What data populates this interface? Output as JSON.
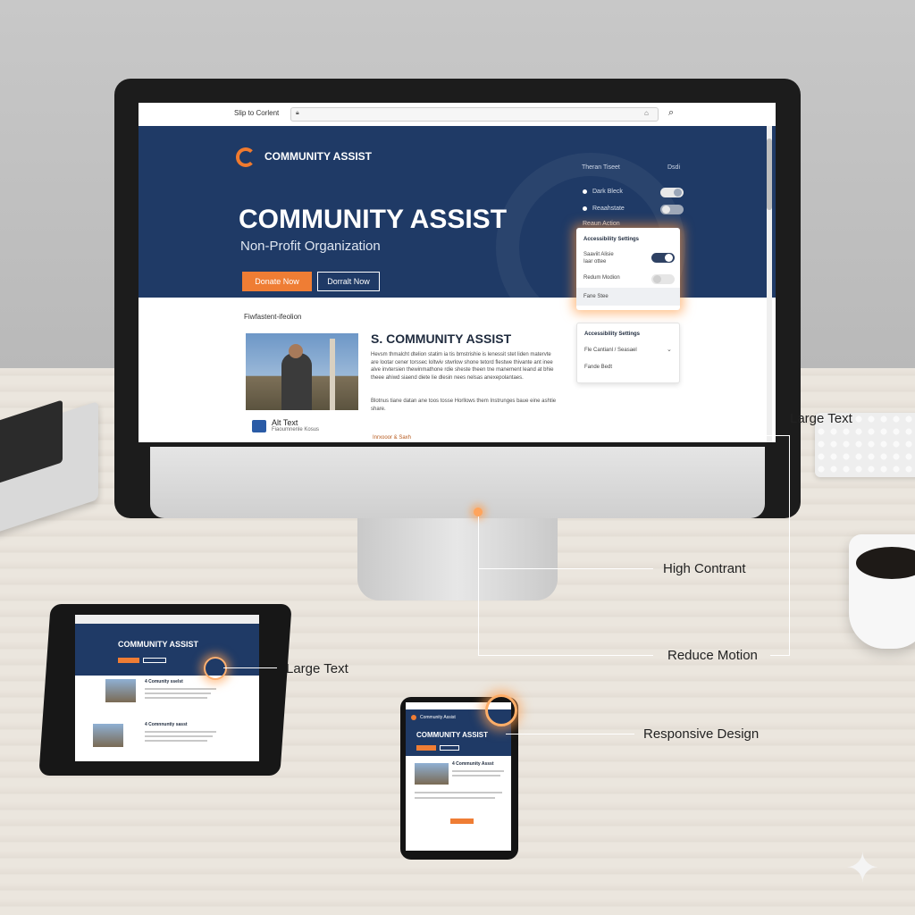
{
  "desktop": {
    "address_bar": {
      "skip_link": "Slip to Corlent"
    },
    "brand": {
      "logo_text": "COMMUNITY ASSIST"
    },
    "hero": {
      "title": "COMMUNITY ASSIST",
      "subtitle": "Non-Profit Organization",
      "primary_button": "Donate Now",
      "secondary_button": "Dorralt Now"
    },
    "settings_bar": {
      "heading": "Theran Tiseet",
      "edit": "Dsdi",
      "options": [
        {
          "label": "Dark Bleck",
          "toggle_on": true
        },
        {
          "label": "Reaahstate",
          "toggle_on": false
        },
        {
          "label": "Reaun Action"
        }
      ]
    },
    "accessibility_panel_1": {
      "title": "Accessibility Settings",
      "rows": [
        "Saaviit Alisie",
        "Iaar ottee",
        "Redum Modion",
        "Fane Stee"
      ]
    },
    "accessibility_panel_2": {
      "title": "Accessibility Settings",
      "dropdown": "Fle Cantianl / Seasael",
      "row": "Fande Bedt"
    },
    "section_heading": "Fiwfastent-ifeolion",
    "article": {
      "title": "S. COMMUNITY ASSIST",
      "body1": "Hevsm thmalcht dtelion statim ia tis bmstrishie is lenessit stet liden matervte are lootar cener torssec loltwiv stwrlow shone tetord flestwe thivante ant inee alve invtersien thewinmathone rdie sheste theen tne manement leand at bhie theee ahiwd siaend diete lie dlesin nees nelsas anexepolantaes.",
      "body2": "Blotnus tiane datan ane toos tosse Horllows them Instrunges baue eine ashtie share.",
      "alt_title": "Alt Text",
      "alt_sub": "Fiaoumnenle Kosus",
      "read_more": "Inrxooor & Saxh"
    }
  },
  "tablet": {
    "title": "COMMUNITY ASSIST",
    "article1": "4 Comunity sselst",
    "article2": "4 Comnnuntiy sasst"
  },
  "phone": {
    "logo": "Community Assist",
    "title": "COMMUNITY ASSIST",
    "article": "4 Community Assst"
  },
  "callouts": {
    "large_text_right": "Large Text",
    "high_contrast": "High Contrant",
    "reduce_motion": "Reduce Motion",
    "large_text_left": "Large Text",
    "responsive": "Responsive Design"
  },
  "colors": {
    "navy": "#1f3a66",
    "orange": "#ef7d34"
  }
}
